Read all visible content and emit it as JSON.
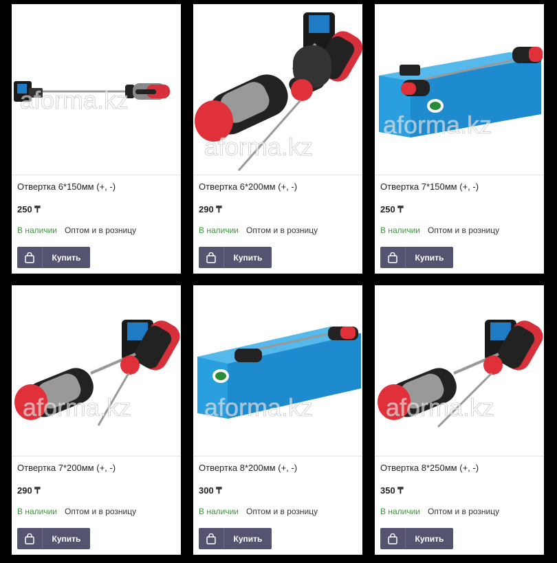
{
  "watermark": "aforma.kz",
  "products": [
    {
      "title": "Отвертка 6*150мм (+, -)",
      "price": "250 ₸",
      "stock": "В наличии",
      "wholesale": "Оптом и в розницу",
      "buy_label": "Купить"
    },
    {
      "title": "Отвертка 6*200мм (+, -)",
      "price": "290 ₸",
      "stock": "В наличии",
      "wholesale": "Оптом и в розницу",
      "buy_label": "Купить"
    },
    {
      "title": "Отвертка 7*150мм (+, -)",
      "price": "250 ₸",
      "stock": "В наличии",
      "wholesale": "Оптом и в розницу",
      "buy_label": "Купить"
    },
    {
      "title": "Отвертка 7*200мм (+, -)",
      "price": "290 ₸",
      "stock": "В наличии",
      "wholesale": "Оптом и в розницу",
      "buy_label": "Купить"
    },
    {
      "title": "Отвертка 8*200мм (+, -)",
      "price": "300 ₸",
      "stock": "В наличии",
      "wholesale": "Оптом и в розницу",
      "buy_label": "Купить"
    },
    {
      "title": "Отвертка 8*250мм (+, -)",
      "price": "350 ₸",
      "stock": "В наличии",
      "wholesale": "Оптом и в розницу",
      "buy_label": "Купить"
    }
  ],
  "colors": {
    "stock": "#3a9a3a",
    "button": "#555470",
    "handle_red": "#e0303a",
    "handle_gray": "#9a9a9a",
    "box_blue": "#2a9fe0"
  }
}
